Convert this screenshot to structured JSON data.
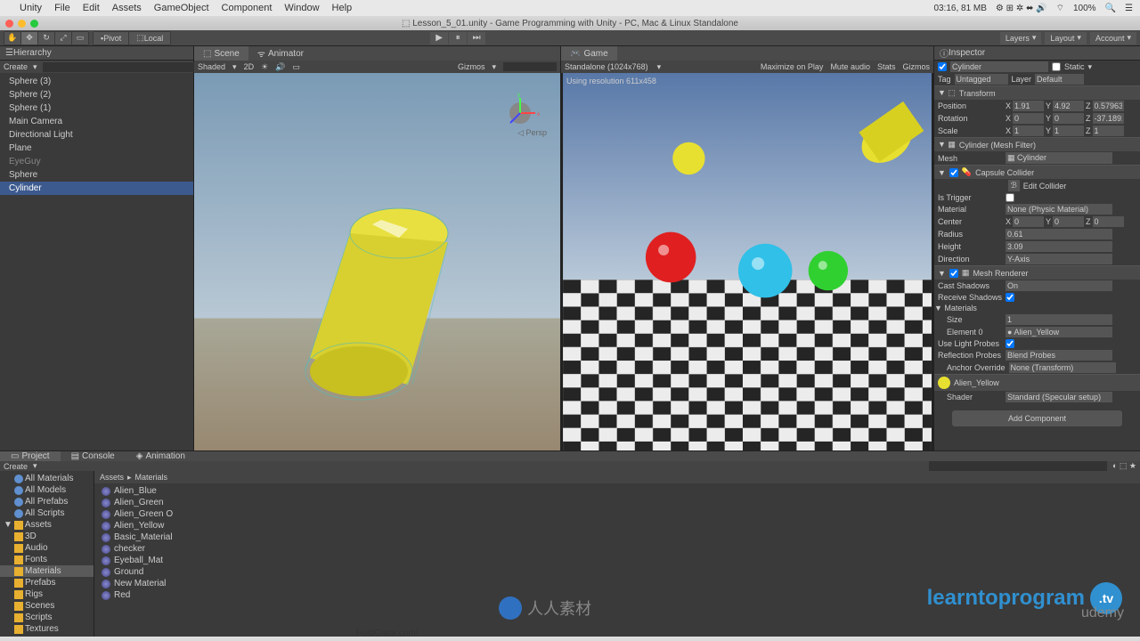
{
  "menubar": {
    "items": [
      "Unity",
      "File",
      "Edit",
      "Assets",
      "GameObject",
      "Component",
      "Window",
      "Help"
    ],
    "status_time": "03:16, 81 MB",
    "battery": "100%",
    "weekday": ""
  },
  "titlebar": {
    "title": "Lesson_5_01.unity - Game Programming with Unity - PC, Mac & Linux Standalone"
  },
  "toolbar": {
    "pivot": "Pivot",
    "local": "Local",
    "layers": "Layers",
    "layout": "Layout",
    "account": "Account"
  },
  "hierarchy": {
    "title": "Hierarchy",
    "create": "Create",
    "items": [
      {
        "label": "Sphere (3)"
      },
      {
        "label": "Sphere (2)"
      },
      {
        "label": "Sphere (1)"
      },
      {
        "label": "Main Camera"
      },
      {
        "label": "Directional Light"
      },
      {
        "label": "Plane"
      },
      {
        "label": "EyeGuy",
        "muted": true
      },
      {
        "label": "Sphere"
      },
      {
        "label": "Cylinder",
        "selected": true
      }
    ]
  },
  "scene": {
    "tab_scene": "Scene",
    "tab_animator": "Animator",
    "shaded": "Shaded",
    "twod": "2D",
    "gizmos": "Gizmos",
    "persp": "Persp"
  },
  "game": {
    "tab": "Game",
    "standalone": "Standalone (1024x768)",
    "resolution_text": "Using resolution 611x458",
    "maximize": "Maximize on Play",
    "mute": "Mute audio",
    "stats": "Stats",
    "gizmos": "Gizmos"
  },
  "inspector": {
    "title": "Inspector",
    "object_name": "Cylinder",
    "static": "Static",
    "tag_label": "Tag",
    "tag_value": "Untagged",
    "layer_label": "Layer",
    "layer_value": "Default",
    "transform": {
      "title": "Transform",
      "position": {
        "label": "Position",
        "x": "1.91",
        "y": "4.92",
        "z": "0.579638"
      },
      "rotation": {
        "label": "Rotation",
        "x": "0",
        "y": "0",
        "z": "-37.1892"
      },
      "scale": {
        "label": "Scale",
        "x": "1",
        "y": "1",
        "z": "1"
      }
    },
    "mesh_filter": {
      "title": "Cylinder (Mesh Filter)",
      "mesh_label": "Mesh",
      "mesh_value": "Cylinder"
    },
    "capsule_collider": {
      "title": "Capsule Collider",
      "edit": "Edit Collider",
      "trigger": "Is Trigger",
      "material_label": "Material",
      "material_value": "None (Physic Material)",
      "center": {
        "label": "Center",
        "x": "0",
        "y": "0",
        "z": "0"
      },
      "radius_label": "Radius",
      "radius": "0.61",
      "height_label": "Height",
      "height": "3.09",
      "direction_label": "Direction",
      "direction": "Y-Axis"
    },
    "mesh_renderer": {
      "title": "Mesh Renderer",
      "cast_label": "Cast Shadows",
      "cast": "On",
      "receive_label": "Receive Shadows",
      "materials_label": "Materials",
      "size_label": "Size",
      "size": "1",
      "element_label": "Element 0",
      "element": "Alien_Yellow",
      "light_probes_label": "Use Light Probes",
      "reflection_label": "Reflection Probes",
      "reflection": "Blend Probes",
      "anchor_label": "Anchor Override",
      "anchor": "None (Transform)"
    },
    "material": {
      "name": "Alien_Yellow",
      "shader_label": "Shader",
      "shader": "Standard (Specular setup)"
    },
    "add_component": "Add Component"
  },
  "project": {
    "tab_project": "Project",
    "tab_console": "Console",
    "tab_animation": "Animation",
    "create": "Create",
    "favorites": [
      {
        "label": "All Materials"
      },
      {
        "label": "All Models"
      },
      {
        "label": "All Prefabs"
      },
      {
        "label": "All Scripts"
      }
    ],
    "assets_label": "Assets",
    "folders": [
      {
        "label": "3D"
      },
      {
        "label": "Audio"
      },
      {
        "label": "Fonts"
      },
      {
        "label": "Materials",
        "selected": true
      },
      {
        "label": "Prefabs"
      },
      {
        "label": "Rigs"
      },
      {
        "label": "Scenes"
      },
      {
        "label": "Scripts"
      },
      {
        "label": "Textures"
      }
    ],
    "breadcrumb": [
      "Assets",
      "Materials"
    ],
    "materials": [
      "Alien_Blue",
      "Alien_Green",
      "Alien_Green O",
      "Alien_Yellow",
      "Basic_Material",
      "checker",
      "Eyeball_Mat",
      "Ground",
      "New Material",
      "Red"
    ]
  },
  "taskbar": {
    "text": "HostGator.com!"
  },
  "watermark": {
    "text": "learntoprogram",
    "tv": ".tv",
    "udemy": "udemy"
  },
  "center_wm": "人人素材"
}
